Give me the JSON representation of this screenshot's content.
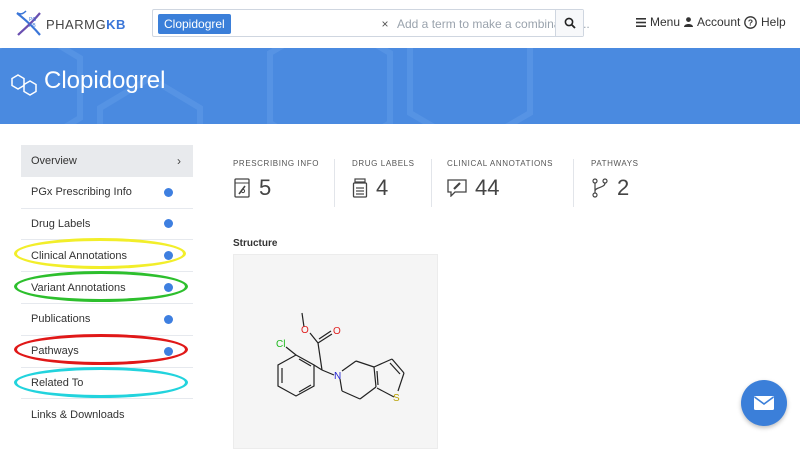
{
  "header": {
    "logo_prefix": "PHARMG",
    "logo_suffix": "KB",
    "logo_badge": "PG KB",
    "search_chip": "Clopidogrel",
    "search_chip_remove": "×",
    "search_placeholder": "Add a term to make a combination...",
    "menu_label": "Menu",
    "account_label": "Account",
    "help_label": "Help"
  },
  "banner": {
    "title": "Clopidogrel"
  },
  "sidebar": {
    "items": [
      {
        "label": "Overview"
      },
      {
        "label": "PGx Prescribing Info"
      },
      {
        "label": "Drug Labels"
      },
      {
        "label": "Clinical Annotations"
      },
      {
        "label": "Variant Annotations"
      },
      {
        "label": "Publications"
      },
      {
        "label": "Pathways"
      },
      {
        "label": "Related To"
      },
      {
        "label": "Links & Downloads"
      }
    ],
    "overview_chevron": "›"
  },
  "stats": [
    {
      "label": "PRESCRIBING INFO",
      "value": "5"
    },
    {
      "label": "DRUG LABELS",
      "value": "4"
    },
    {
      "label": "CLINICAL ANNOTATIONS",
      "value": "44"
    },
    {
      "label": "PATHWAYS",
      "value": "2"
    }
  ],
  "structure": {
    "title": "Structure",
    "atoms": {
      "cl": "Cl",
      "o1": "O",
      "o2": "O",
      "n": "N",
      "s": "S"
    }
  },
  "colors": {
    "accent": "#3b7fd9",
    "banner": "#4a8ae0",
    "dot": "#3e7fe0",
    "ring_yellow": "#f2ee2a",
    "ring_green": "#2dbf2d",
    "ring_red": "#e01818",
    "ring_cyan": "#22d3dd"
  },
  "icons": [
    "search-icon",
    "menu-icon",
    "account-icon",
    "help-icon",
    "molecule-icon",
    "prescription-icon",
    "drug-label-icon",
    "annotation-icon",
    "pathway-icon",
    "mail-icon"
  ]
}
